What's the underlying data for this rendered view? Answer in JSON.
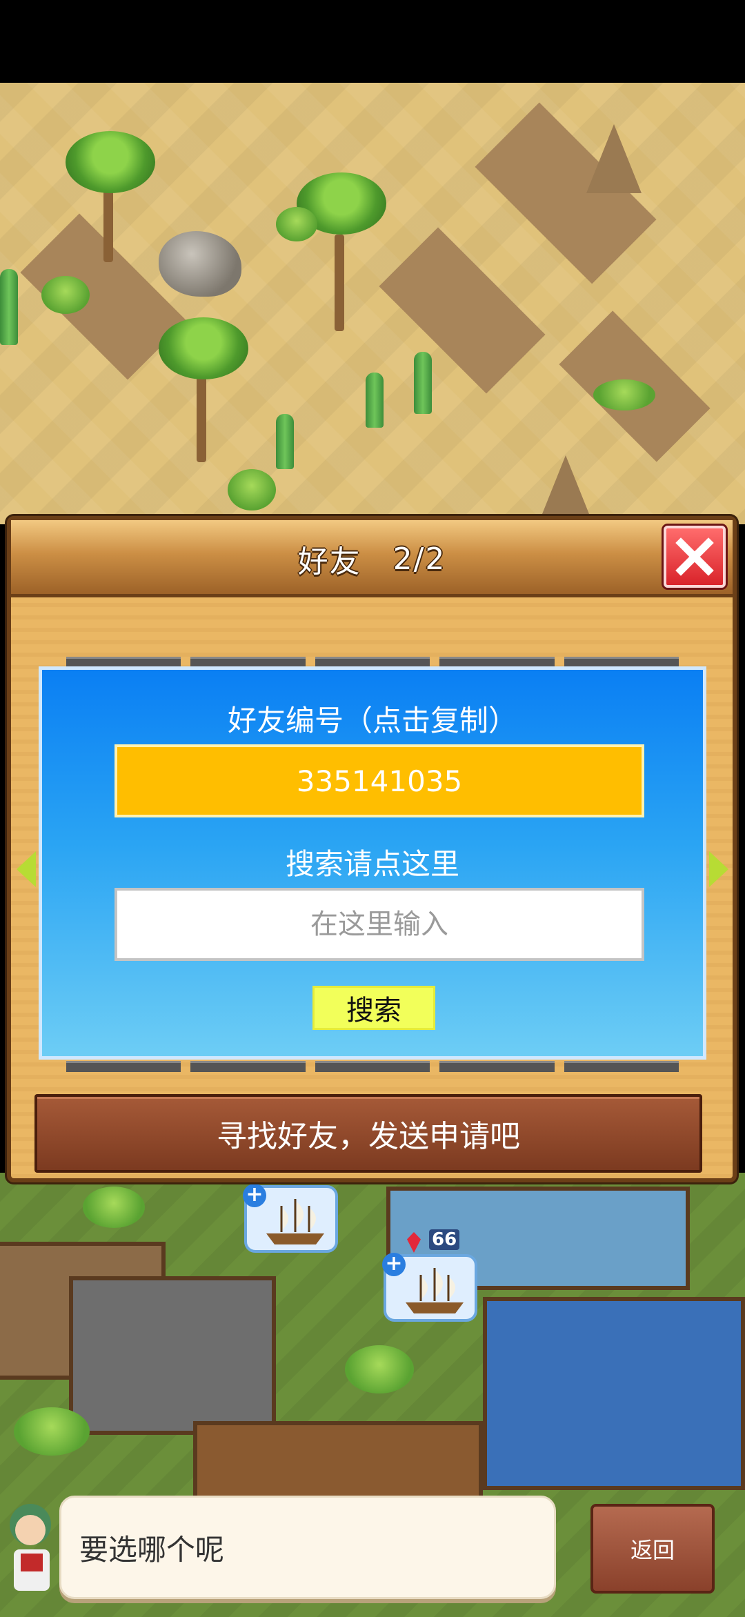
{
  "dialog": {
    "title": "好友",
    "page_indicator": "2/2",
    "friend_id_label": "好友编号（点击复制）",
    "friend_id": "335141035",
    "search_label": "搜索请点这里",
    "search_placeholder": "在这里输入",
    "search_button": "搜索",
    "find_friends_text": "寻找好友，发送申请吧"
  },
  "prompt": {
    "text": "要选哪个呢",
    "back_button": "返回"
  },
  "town": {
    "ship_badge_count": "66"
  },
  "colors": {
    "panel_blue": "#0a7ff3",
    "id_box": "#ffbe00",
    "search_button": "#f2ff5a",
    "close_button": "#d9232a"
  }
}
